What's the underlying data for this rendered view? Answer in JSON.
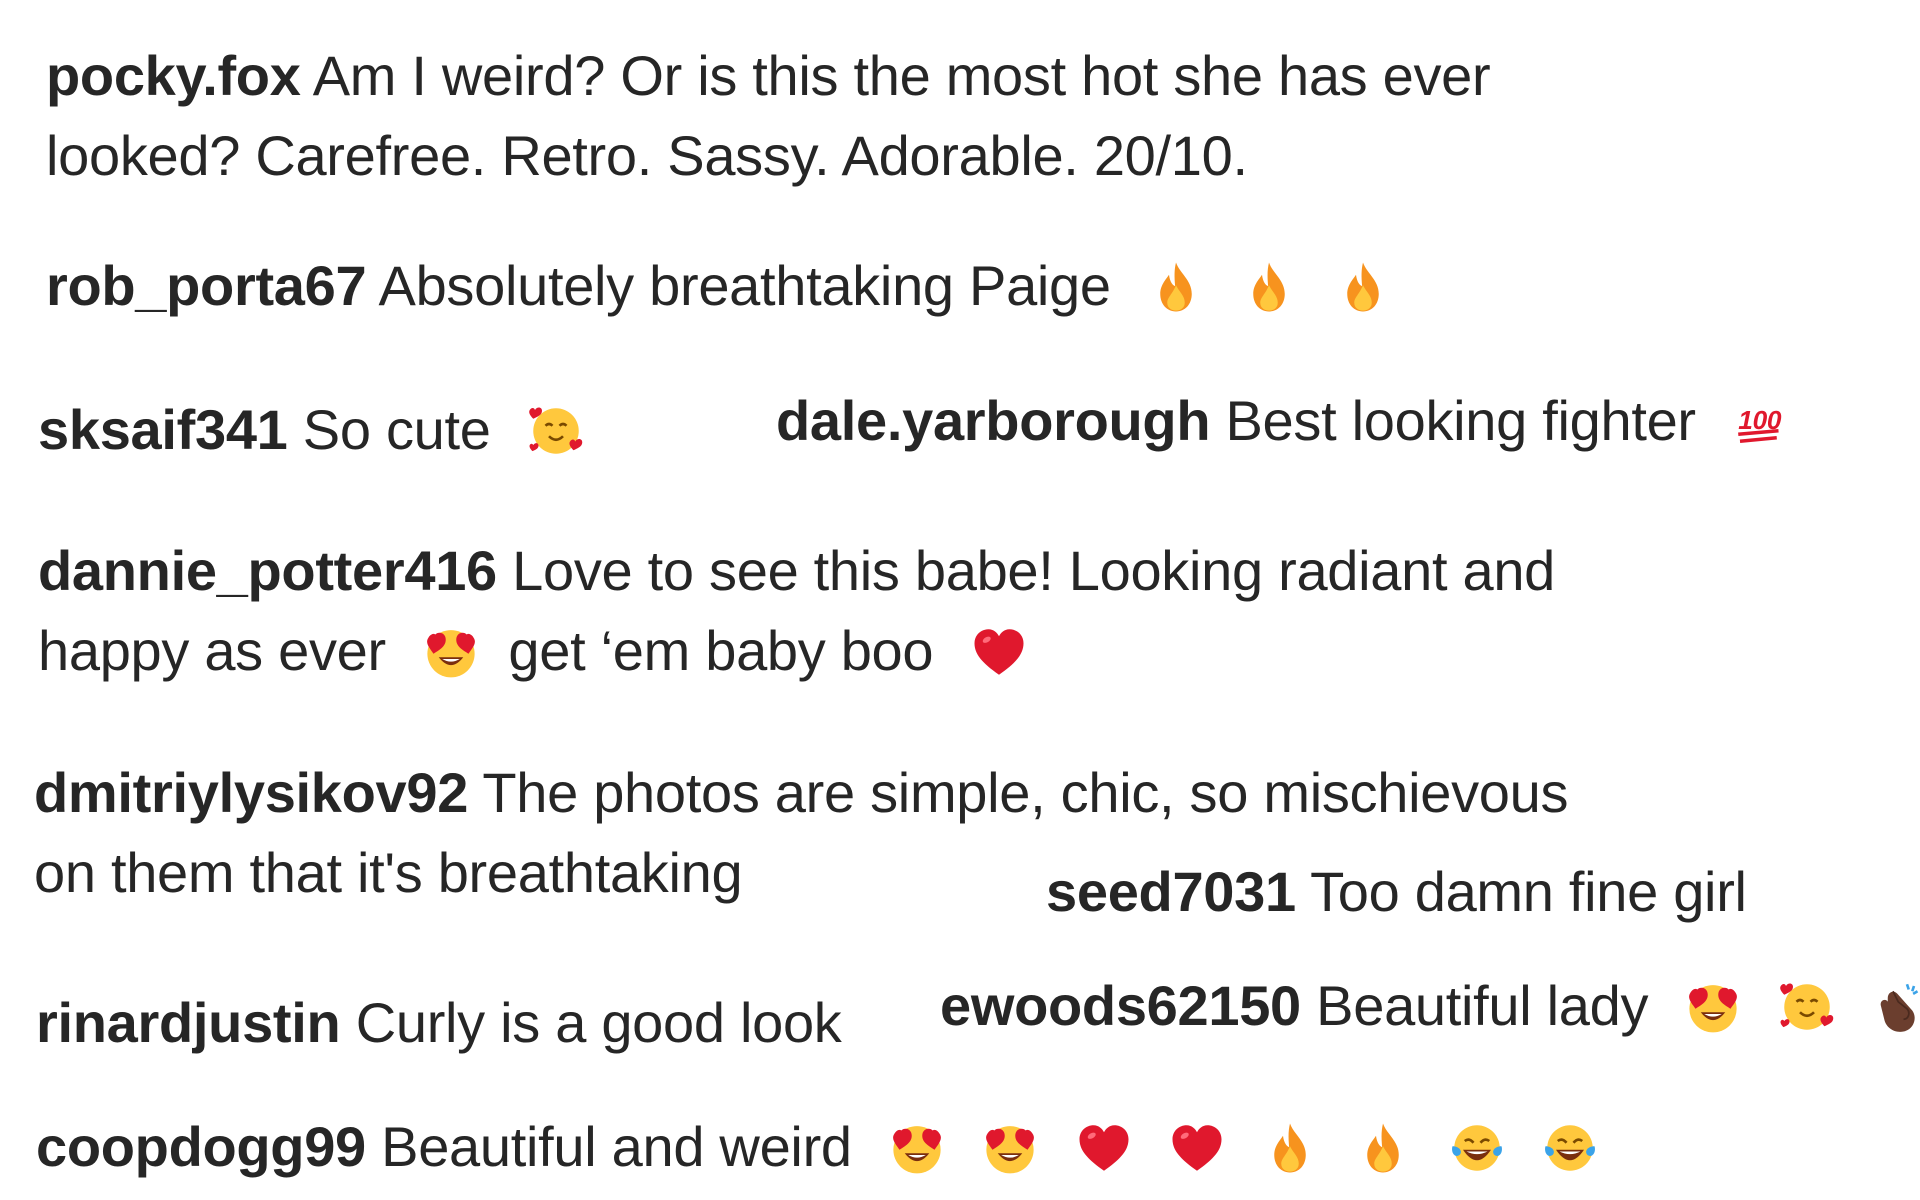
{
  "comments": [
    {
      "username": "pocky.fox",
      "line1": "Am I weird? Or is this the most hot she has ever",
      "line2": "looked? Carefree. Retro. Sassy. Adorable. 20/10."
    },
    {
      "username": "rob_porta67",
      "text": "Absolutely breathtaking Paige",
      "emojis": [
        "fire-icon",
        "fire-icon",
        "fire-icon"
      ]
    },
    {
      "username": "sksaif341",
      "text": "So cute",
      "emojis": [
        "smiling-face-with-hearts-icon"
      ]
    },
    {
      "username": "dale.yarborough",
      "text": "Best looking fighter",
      "emojis": [
        "hundred-points-icon"
      ]
    },
    {
      "username": "dannie_potter416",
      "line1": "Love to see this babe! Looking radiant and",
      "line2a": "happy as ever",
      "line2b": "get ‘em baby boo",
      "emojis": [
        "heart-eyes-icon",
        "red-heart-icon"
      ]
    },
    {
      "username": "dmitriylysikov92",
      "line1": "The photos are simple, chic, so mischievous",
      "line2": "on them that it's breathtaking"
    },
    {
      "username": "seed7031",
      "text": "Too damn fine girl"
    },
    {
      "username": "rinardjustin",
      "text": "Curly is a good look"
    },
    {
      "username": "ewoods62150",
      "text": "Beautiful lady",
      "emojis": [
        "heart-eyes-icon",
        "smiling-face-with-hearts-icon",
        "clapping-hands-icon"
      ]
    },
    {
      "username": "coopdogg99",
      "text": "Beautiful and weird",
      "emojis": [
        "heart-eyes-icon",
        "heart-eyes-icon",
        "red-heart-icon",
        "red-heart-icon",
        "fire-icon",
        "fire-icon",
        "tears-of-joy-icon",
        "tears-of-joy-icon"
      ]
    }
  ],
  "colors": {
    "text": "#262626",
    "fire_outer": "#F7931E",
    "fire_inner": "#FFC83D",
    "heart": "#E0182D",
    "face": "#FFC83D",
    "hundred": "#E0182D"
  }
}
